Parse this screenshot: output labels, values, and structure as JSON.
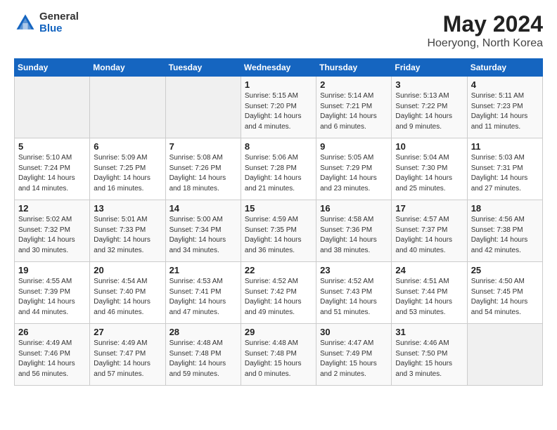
{
  "header": {
    "logo_general": "General",
    "logo_blue": "Blue",
    "main_title": "May 2024",
    "subtitle": "Hoeryong, North Korea"
  },
  "weekdays": [
    "Sunday",
    "Monday",
    "Tuesday",
    "Wednesday",
    "Thursday",
    "Friday",
    "Saturday"
  ],
  "weeks": [
    [
      {
        "date": "",
        "info": ""
      },
      {
        "date": "",
        "info": ""
      },
      {
        "date": "",
        "info": ""
      },
      {
        "date": "1",
        "info": "Sunrise: 5:15 AM\nSunset: 7:20 PM\nDaylight: 14 hours\nand 4 minutes."
      },
      {
        "date": "2",
        "info": "Sunrise: 5:14 AM\nSunset: 7:21 PM\nDaylight: 14 hours\nand 6 minutes."
      },
      {
        "date": "3",
        "info": "Sunrise: 5:13 AM\nSunset: 7:22 PM\nDaylight: 14 hours\nand 9 minutes."
      },
      {
        "date": "4",
        "info": "Sunrise: 5:11 AM\nSunset: 7:23 PM\nDaylight: 14 hours\nand 11 minutes."
      }
    ],
    [
      {
        "date": "5",
        "info": "Sunrise: 5:10 AM\nSunset: 7:24 PM\nDaylight: 14 hours\nand 14 minutes."
      },
      {
        "date": "6",
        "info": "Sunrise: 5:09 AM\nSunset: 7:25 PM\nDaylight: 14 hours\nand 16 minutes."
      },
      {
        "date": "7",
        "info": "Sunrise: 5:08 AM\nSunset: 7:26 PM\nDaylight: 14 hours\nand 18 minutes."
      },
      {
        "date": "8",
        "info": "Sunrise: 5:06 AM\nSunset: 7:28 PM\nDaylight: 14 hours\nand 21 minutes."
      },
      {
        "date": "9",
        "info": "Sunrise: 5:05 AM\nSunset: 7:29 PM\nDaylight: 14 hours\nand 23 minutes."
      },
      {
        "date": "10",
        "info": "Sunrise: 5:04 AM\nSunset: 7:30 PM\nDaylight: 14 hours\nand 25 minutes."
      },
      {
        "date": "11",
        "info": "Sunrise: 5:03 AM\nSunset: 7:31 PM\nDaylight: 14 hours\nand 27 minutes."
      }
    ],
    [
      {
        "date": "12",
        "info": "Sunrise: 5:02 AM\nSunset: 7:32 PM\nDaylight: 14 hours\nand 30 minutes."
      },
      {
        "date": "13",
        "info": "Sunrise: 5:01 AM\nSunset: 7:33 PM\nDaylight: 14 hours\nand 32 minutes."
      },
      {
        "date": "14",
        "info": "Sunrise: 5:00 AM\nSunset: 7:34 PM\nDaylight: 14 hours\nand 34 minutes."
      },
      {
        "date": "15",
        "info": "Sunrise: 4:59 AM\nSunset: 7:35 PM\nDaylight: 14 hours\nand 36 minutes."
      },
      {
        "date": "16",
        "info": "Sunrise: 4:58 AM\nSunset: 7:36 PM\nDaylight: 14 hours\nand 38 minutes."
      },
      {
        "date": "17",
        "info": "Sunrise: 4:57 AM\nSunset: 7:37 PM\nDaylight: 14 hours\nand 40 minutes."
      },
      {
        "date": "18",
        "info": "Sunrise: 4:56 AM\nSunset: 7:38 PM\nDaylight: 14 hours\nand 42 minutes."
      }
    ],
    [
      {
        "date": "19",
        "info": "Sunrise: 4:55 AM\nSunset: 7:39 PM\nDaylight: 14 hours\nand 44 minutes."
      },
      {
        "date": "20",
        "info": "Sunrise: 4:54 AM\nSunset: 7:40 PM\nDaylight: 14 hours\nand 46 minutes."
      },
      {
        "date": "21",
        "info": "Sunrise: 4:53 AM\nSunset: 7:41 PM\nDaylight: 14 hours\nand 47 minutes."
      },
      {
        "date": "22",
        "info": "Sunrise: 4:52 AM\nSunset: 7:42 PM\nDaylight: 14 hours\nand 49 minutes."
      },
      {
        "date": "23",
        "info": "Sunrise: 4:52 AM\nSunset: 7:43 PM\nDaylight: 14 hours\nand 51 minutes."
      },
      {
        "date": "24",
        "info": "Sunrise: 4:51 AM\nSunset: 7:44 PM\nDaylight: 14 hours\nand 53 minutes."
      },
      {
        "date": "25",
        "info": "Sunrise: 4:50 AM\nSunset: 7:45 PM\nDaylight: 14 hours\nand 54 minutes."
      }
    ],
    [
      {
        "date": "26",
        "info": "Sunrise: 4:49 AM\nSunset: 7:46 PM\nDaylight: 14 hours\nand 56 minutes."
      },
      {
        "date": "27",
        "info": "Sunrise: 4:49 AM\nSunset: 7:47 PM\nDaylight: 14 hours\nand 57 minutes."
      },
      {
        "date": "28",
        "info": "Sunrise: 4:48 AM\nSunset: 7:48 PM\nDaylight: 14 hours\nand 59 minutes."
      },
      {
        "date": "29",
        "info": "Sunrise: 4:48 AM\nSunset: 7:48 PM\nDaylight: 15 hours\nand 0 minutes."
      },
      {
        "date": "30",
        "info": "Sunrise: 4:47 AM\nSunset: 7:49 PM\nDaylight: 15 hours\nand 2 minutes."
      },
      {
        "date": "31",
        "info": "Sunrise: 4:46 AM\nSunset: 7:50 PM\nDaylight: 15 hours\nand 3 minutes."
      },
      {
        "date": "",
        "info": ""
      }
    ]
  ]
}
